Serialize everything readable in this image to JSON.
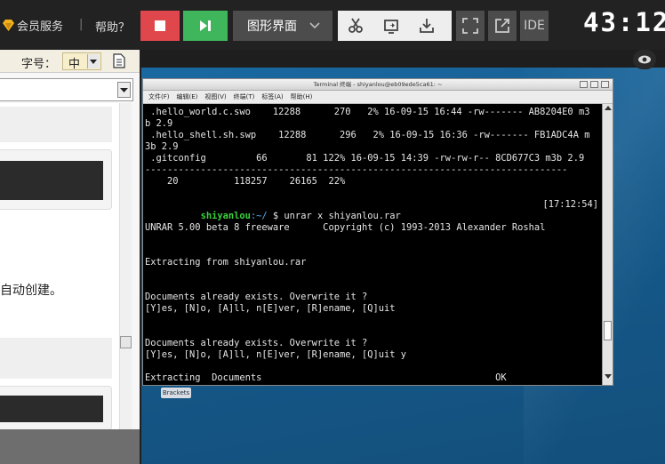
{
  "topbar": {
    "vip_label": "会员服务",
    "separator": "|",
    "help_label": "帮助？",
    "mode_label": "图形界面",
    "ide_label": "IDE",
    "timer": "43:12"
  },
  "left_panel": {
    "font_label": "字号：",
    "font_value": "中",
    "text_snippet": "自动创建。"
  },
  "desktop": {
    "desktop_icon_label": "Brackets"
  },
  "terminal": {
    "title": "Terminal 终端 - shiyanlou@eb09ede5ca61: ~",
    "menu": [
      "文件(F)",
      "编辑(E)",
      "视图(V)",
      "终端(T)",
      "标签(A)",
      "帮助(H)"
    ],
    "lines": [
      " .hello_world.c.swo    12288      270   2% 16-09-15 16:44 -rw------- AB8204E0 m3",
      "b 2.9",
      " .hello_shell.sh.swp    12288      296   2% 16-09-15 16:36 -rw------- FB1ADC4A m",
      "3b 2.9",
      " .gitconfig         66       81 122% 16-09-15 14:39 -rw-rw-r-- 8CD677C3 m3b 2.9",
      "----------------------------------------------------------------------------",
      "    20          118257    26165  22%",
      "",
      "",
      "",
      "UNRAR 5.00 beta 8 freeware      Copyright (c) 1993-2013 Alexander Roshal",
      "",
      "",
      "Extracting from shiyanlou.rar",
      "",
      "",
      "Documents already exists. Overwrite it ?",
      "[Y]es, [N]o, [A]ll, n[E]ver, [R]ename, [Q]uit",
      "",
      "",
      "Documents already exists. Overwrite it ?",
      "[Y]es, [N]o, [A]ll, n[E]ver, [R]ename, [Q]uit y",
      "",
      "Extracting  Documents                                          OK"
    ],
    "prompt": {
      "user": "shiyanlou",
      "path": ":~/",
      "command": " $ unrar x shiyanlou.rar",
      "time": "[17:12:54]"
    }
  }
}
